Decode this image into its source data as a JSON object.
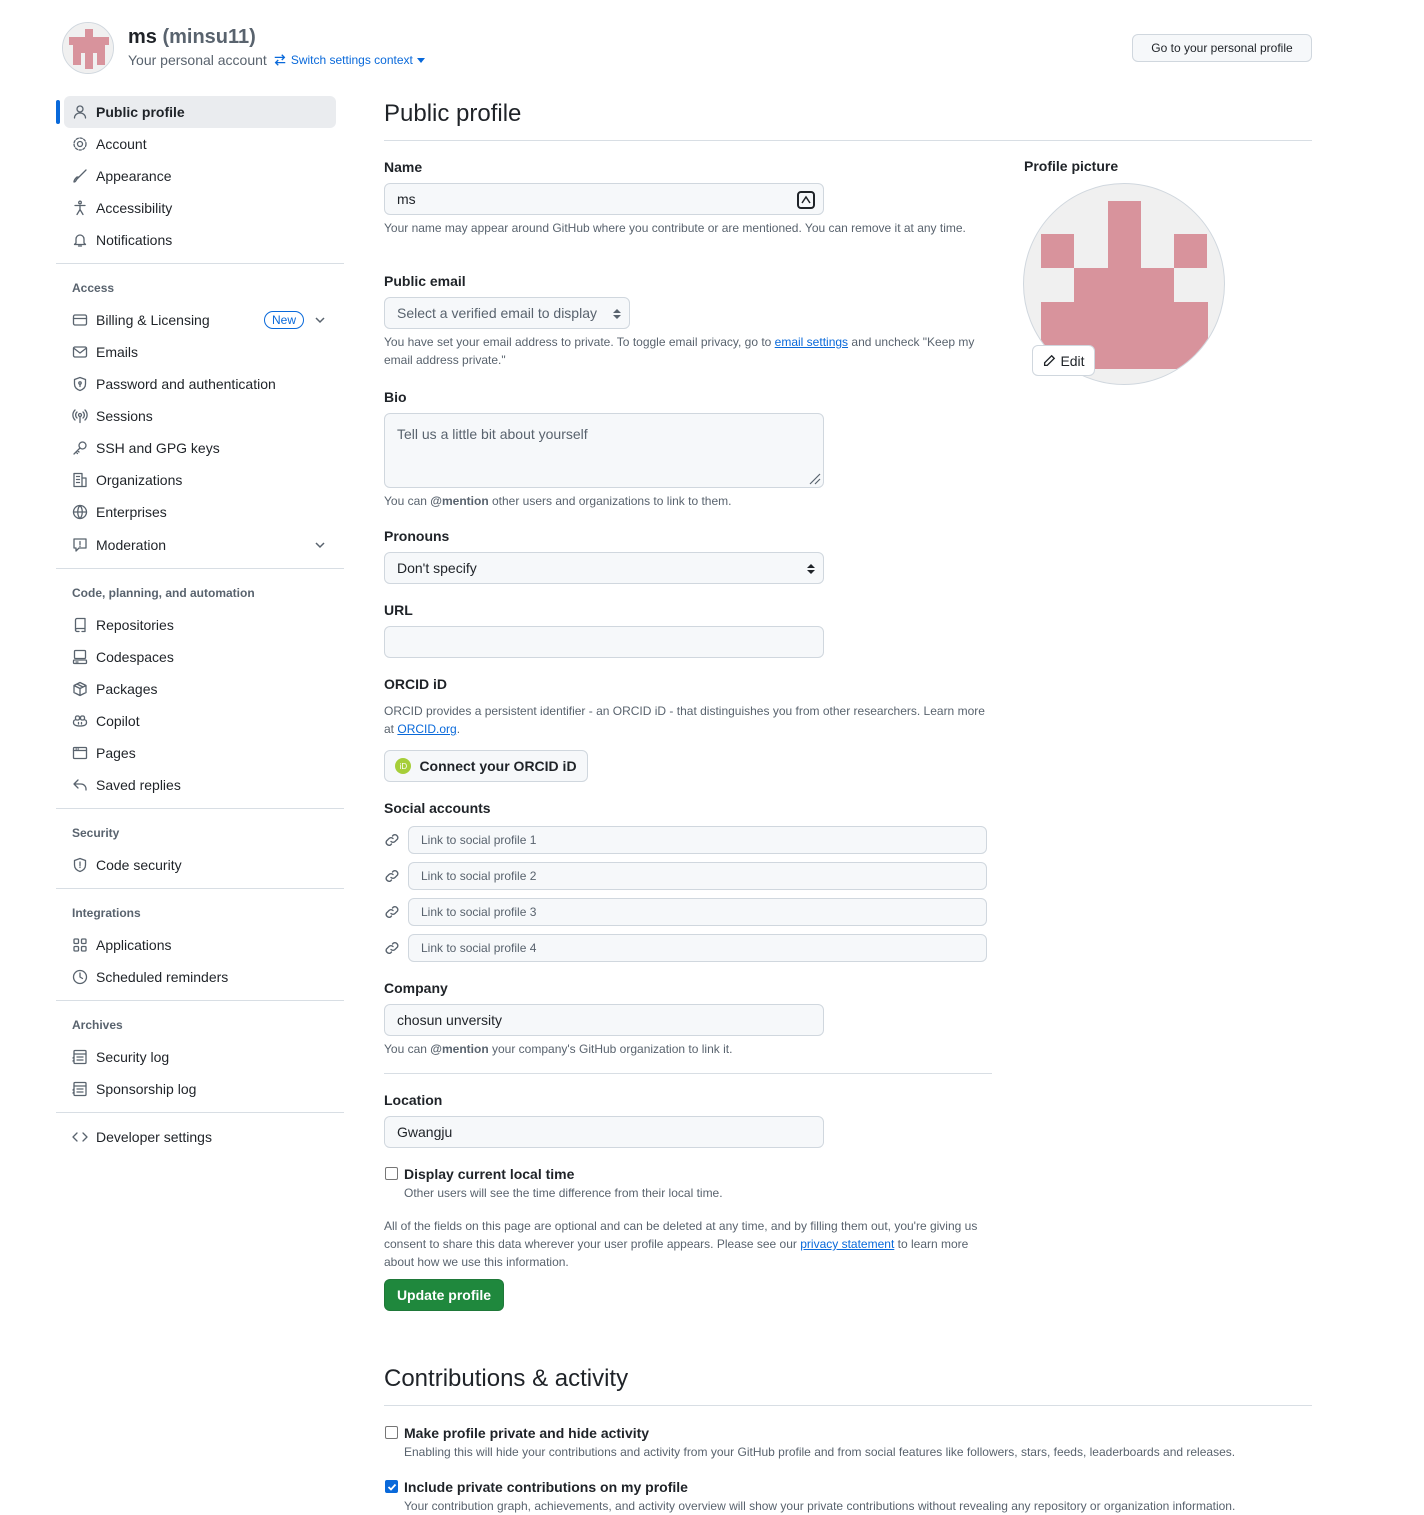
{
  "header": {
    "display_name": "ms",
    "username": "(minsu11)",
    "subtitle": "Your personal account",
    "switch_label": "Switch settings context",
    "profile_button": "Go to your personal profile"
  },
  "sidebar": {
    "main_items": [
      {
        "label": "Public profile",
        "icon": "person-icon"
      },
      {
        "label": "Account",
        "icon": "gear-icon"
      },
      {
        "label": "Appearance",
        "icon": "paintbrush-icon"
      },
      {
        "label": "Accessibility",
        "icon": "accessibility-icon"
      },
      {
        "label": "Notifications",
        "icon": "bell-icon"
      }
    ],
    "access_heading": "Access",
    "access_items": [
      {
        "label": "Billing & Licensing",
        "icon": "credit-card-icon",
        "badge": "New"
      },
      {
        "label": "Emails",
        "icon": "mail-icon"
      },
      {
        "label": "Password and authentication",
        "icon": "shield-lock-icon"
      },
      {
        "label": "Sessions",
        "icon": "broadcast-icon"
      },
      {
        "label": "SSH and GPG keys",
        "icon": "key-icon"
      },
      {
        "label": "Organizations",
        "icon": "organization-icon"
      },
      {
        "label": "Enterprises",
        "icon": "globe-icon"
      },
      {
        "label": "Moderation",
        "icon": "report-icon"
      }
    ],
    "code_heading": "Code, planning, and automation",
    "code_items": [
      {
        "label": "Repositories",
        "icon": "repo-icon"
      },
      {
        "label": "Codespaces",
        "icon": "codespaces-icon"
      },
      {
        "label": "Packages",
        "icon": "package-icon"
      },
      {
        "label": "Copilot",
        "icon": "copilot-icon"
      },
      {
        "label": "Pages",
        "icon": "browser-icon"
      },
      {
        "label": "Saved replies",
        "icon": "reply-icon"
      }
    ],
    "security_heading": "Security",
    "security_items": [
      {
        "label": "Code security",
        "icon": "shield-icon"
      }
    ],
    "integrations_heading": "Integrations",
    "integrations_items": [
      {
        "label": "Applications",
        "icon": "apps-icon"
      },
      {
        "label": "Scheduled reminders",
        "icon": "clock-icon"
      }
    ],
    "archives_heading": "Archives",
    "archives_items": [
      {
        "label": "Security log",
        "icon": "log-icon"
      },
      {
        "label": "Sponsorship log",
        "icon": "log-icon"
      }
    ],
    "developer_item": {
      "label": "Developer settings",
      "icon": "code-icon"
    }
  },
  "main": {
    "title": "Public profile",
    "name": {
      "label": "Name",
      "value": "ms",
      "note": "Your name may appear around GitHub where you contribute or are mentioned. You can remove it at any time."
    },
    "email": {
      "label": "Public email",
      "placeholder": "Select a verified email to display",
      "note_before": "You have set your email address to private. To toggle email privacy, go to",
      "note_link": "email settings",
      "note_after": "and uncheck \"Keep my email address private.\""
    },
    "bio": {
      "label": "Bio",
      "placeholder": "Tell us a little bit about yourself",
      "note_before": "You can",
      "note_bold": "@mention",
      "note_after": "other users and organizations to link to them."
    },
    "pronouns": {
      "label": "Pronouns",
      "value": "Don't specify"
    },
    "url": {
      "label": "URL",
      "value": ""
    },
    "orcid": {
      "label": "ORCID iD",
      "note_before": "ORCID provides a persistent identifier - an ORCID iD - that distinguishes you from other researchers. Learn more at",
      "note_link": "ORCID.org",
      "note_after": ".",
      "button": "Connect your ORCID iD",
      "badge": "iD"
    },
    "social": {
      "label": "Social accounts",
      "placeholders": [
        "Link to social profile 1",
        "Link to social profile 2",
        "Link to social profile 3",
        "Link to social profile 4"
      ]
    },
    "company": {
      "label": "Company",
      "value": "chosun unversity",
      "note_before": "You can",
      "note_bold": "@mention",
      "note_after": "your company's GitHub organization to link it."
    },
    "location": {
      "label": "Location",
      "value": "Gwangju"
    },
    "local_time": {
      "label": "Display current local time",
      "note": "Other users will see the time difference from their local time.",
      "checked": false
    },
    "consent": {
      "before": "All of the fields on this page are optional and can be deleted at any time, and by filling them out, you're giving us consent to share this data wherever your user profile appears. Please see our",
      "link": "privacy statement",
      "after": "to learn more about how we use this information."
    },
    "update_button": "Update profile",
    "profile_picture": {
      "label": "Profile picture",
      "edit": "Edit",
      "avatar_color": "#d8939c"
    }
  },
  "contributions": {
    "title": "Contributions & activity",
    "private": {
      "label": "Make profile private and hide activity",
      "note": "Enabling this will hide your contributions and activity from your GitHub profile and from social features like followers, stars, feeds, leaderboards and releases.",
      "checked": false
    },
    "include_private": {
      "label": "Include private contributions on my profile",
      "note": "Your contribution graph, achievements, and activity overview will show your private contributions without revealing any repository or organization information.",
      "checked": true
    }
  }
}
